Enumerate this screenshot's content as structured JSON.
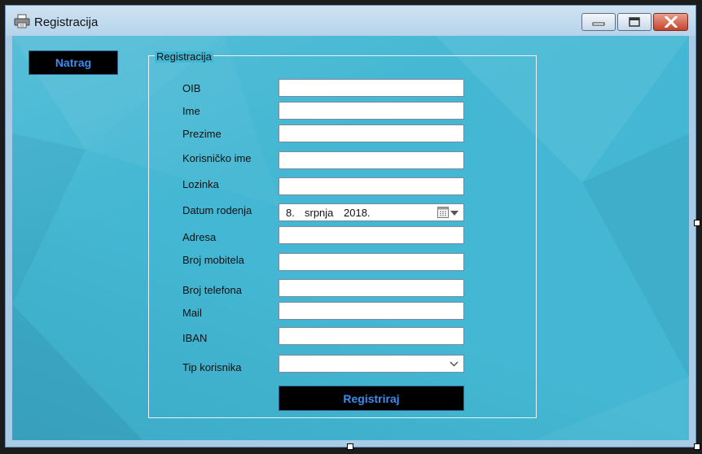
{
  "window": {
    "title": "Registracija",
    "icon": "printer-icon"
  },
  "title_buttons": {
    "minimize_icon": "minimize-icon",
    "maximize_icon": "maximize-icon",
    "close_icon": "close-icon"
  },
  "back_button": {
    "label": "Natrag"
  },
  "group": {
    "legend": "Registracija"
  },
  "fields": {
    "oib": {
      "label": "OIB",
      "value": ""
    },
    "ime": {
      "label": "Ime",
      "value": ""
    },
    "prezime": {
      "label": "Prezime",
      "value": ""
    },
    "korisnicko_ime": {
      "label": "Korisničko ime",
      "value": ""
    },
    "lozinka": {
      "label": "Lozinka",
      "value": ""
    },
    "datum_rodenja": {
      "label": "Datum rodenja",
      "day": "8.",
      "month": "srpnja",
      "year": "2018."
    },
    "adresa": {
      "label": "Adresa",
      "value": ""
    },
    "broj_mobitela": {
      "label": "Broj mobitela",
      "value": ""
    },
    "broj_telefona": {
      "label": "Broj telefona",
      "value": ""
    },
    "mail": {
      "label": "Mail",
      "value": ""
    },
    "iban": {
      "label": "IBAN",
      "value": ""
    },
    "tip_korisnika": {
      "label": "Tip korisnika",
      "value": ""
    }
  },
  "submit_button": {
    "label": "Registriraj"
  },
  "colors": {
    "background": "#43b7d3",
    "button_bg": "#000000",
    "button_text": "#3b8cf0"
  }
}
